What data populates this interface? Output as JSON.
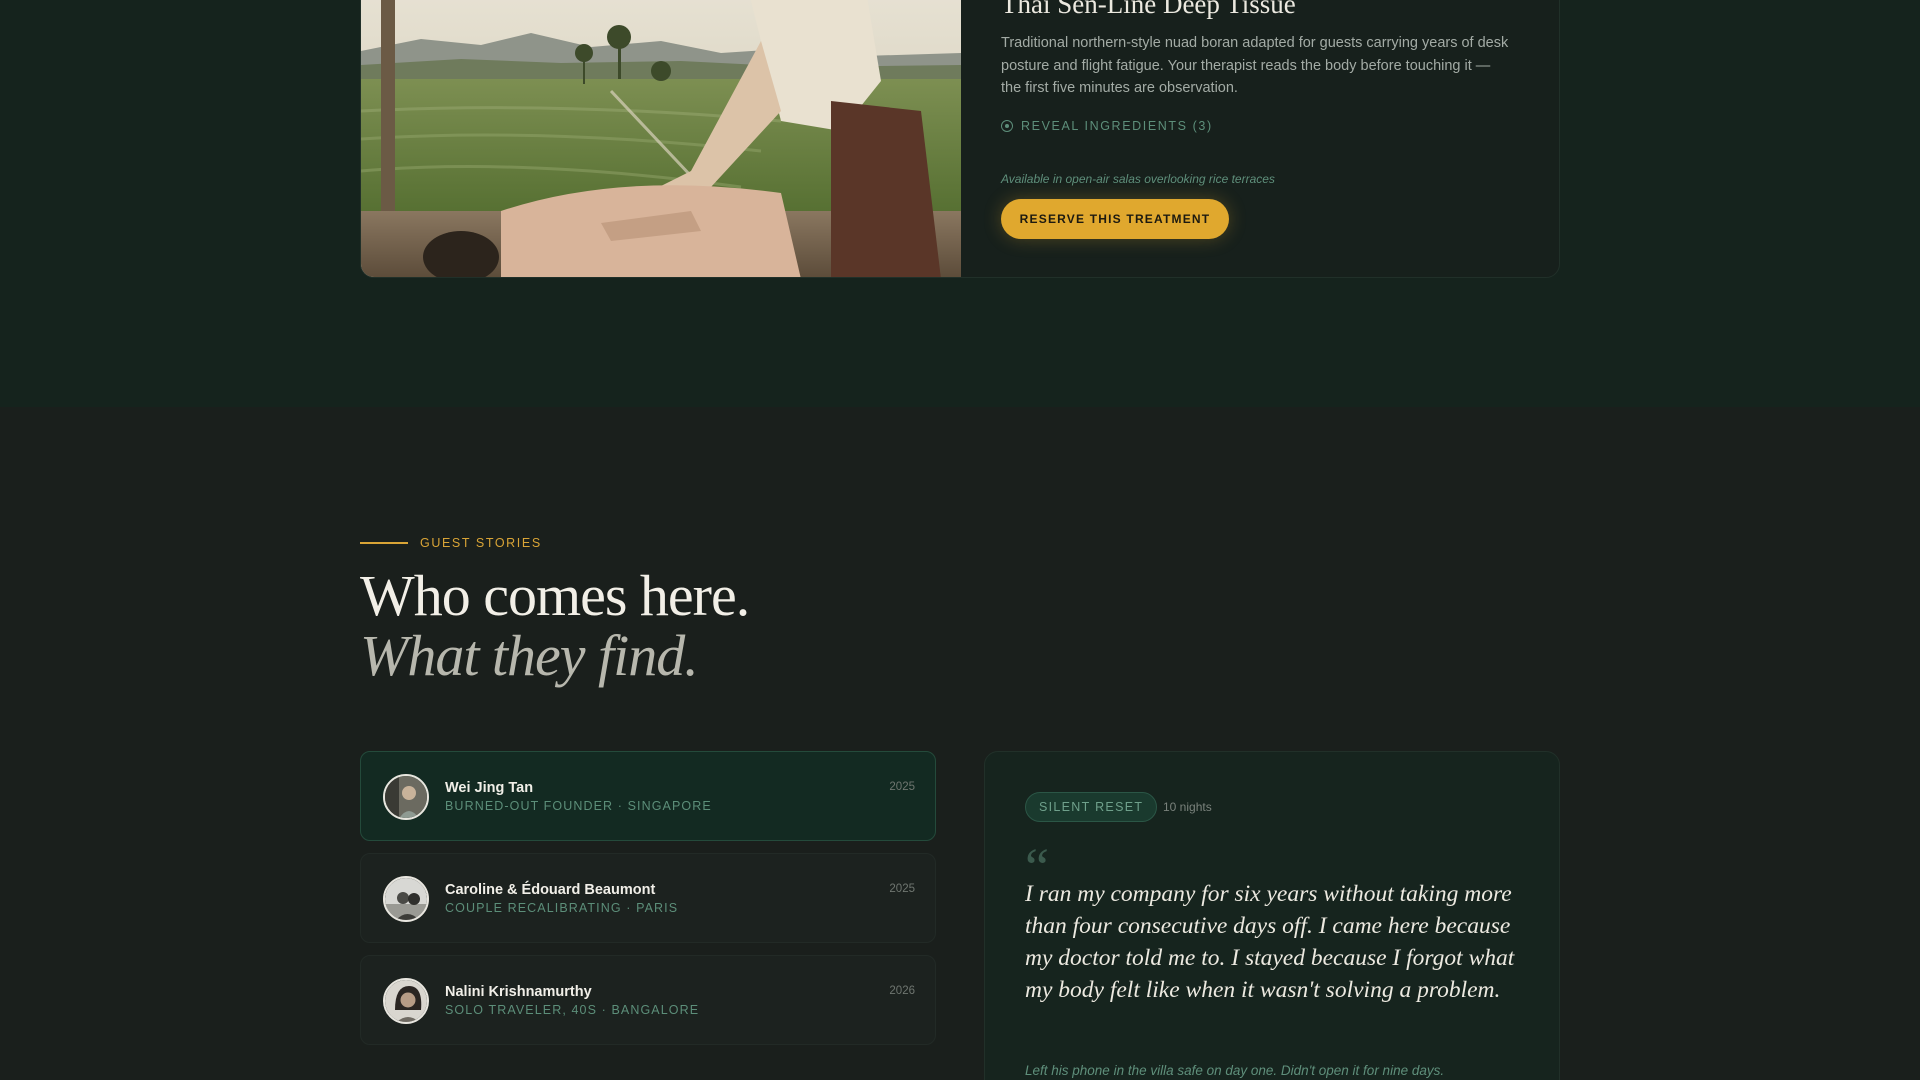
{
  "treatment": {
    "title": "Thai Sen-Line Deep Tissue",
    "description": "Traditional northern-style nuad boran adapted for guests carrying years of desk posture and flight fatigue. Your therapist reads the body before touching it — the first five minutes are observation.",
    "reveal_label": "REVEAL INGREDIENTS (3)",
    "availability": "Available in open-air salas overlooking rice terraces",
    "reserve_label": "RESERVE THIS TREATMENT"
  },
  "guest_stories": {
    "eyebrow": "GUEST STORIES",
    "heading_line1": "Who comes here.",
    "heading_line2": "What they find.",
    "guests": [
      {
        "name": "Wei Jing Tan",
        "meta": "BURNED-OUT FOUNDER · SINGAPORE",
        "year": "2025"
      },
      {
        "name": "Caroline & Édouard Beaumont",
        "meta": "COUPLE RECALIBRATING · PARIS",
        "year": "2025"
      },
      {
        "name": "Nalini Krishnamurthy",
        "meta": "SOLO TRAVELER, 40S · BANGALORE",
        "year": "2026"
      }
    ],
    "active_story": {
      "tag": "SILENT RESET",
      "nights": "10 nights",
      "quote_mark": "“",
      "quote": "I ran my company for six years without taking more than four consecutive days off. I came here because my doctor told me to. I stayed because I forgot what my body felt like when it wasn't solving a problem.",
      "footnote": "Left his phone in the villa safe on day one. Didn't open it for nine days."
    }
  },
  "colors": {
    "accent_gold": "#e0a82e",
    "accent_green": "#5d8e7a",
    "bg_dark": "#1a1f1c",
    "bg_forest": "#15231d"
  }
}
